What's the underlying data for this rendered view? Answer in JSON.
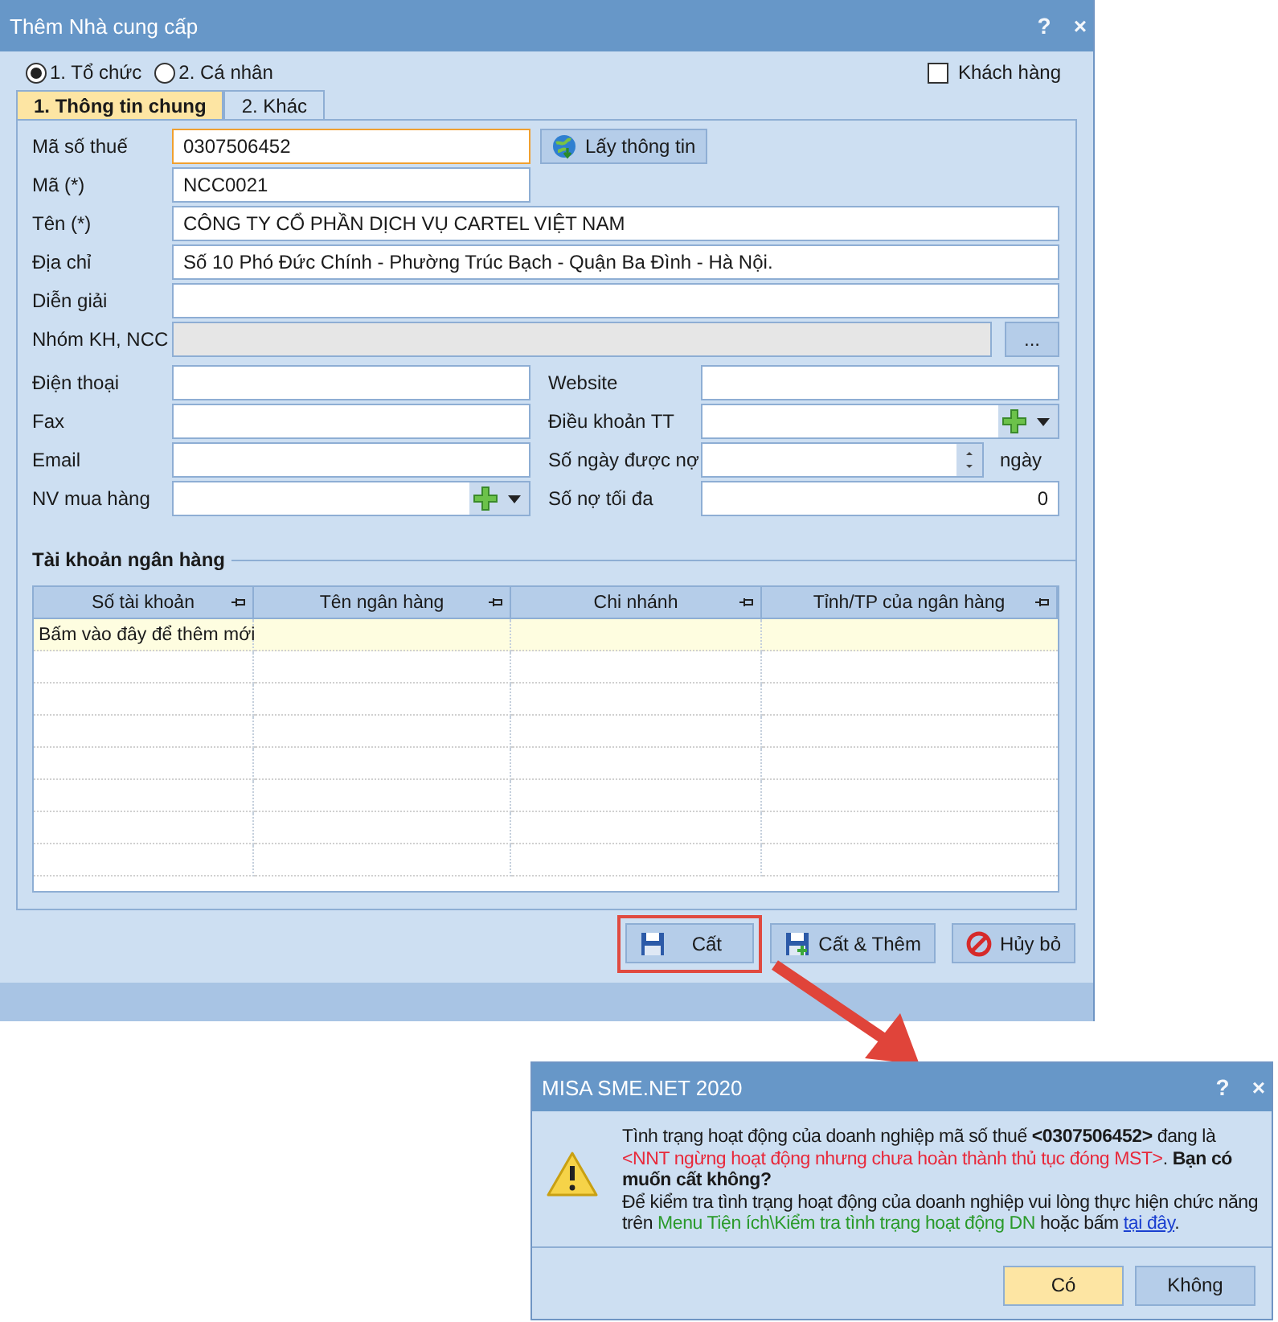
{
  "window": {
    "title": "Thêm Nhà cung cấp",
    "help": "?",
    "close": "×"
  },
  "radio_options": [
    {
      "label": "1. Tổ chức",
      "selected": true
    },
    {
      "label": "2. Cá nhân",
      "selected": false
    }
  ],
  "customer_checkbox": {
    "label": "Khách hàng",
    "checked": false
  },
  "tabs": [
    {
      "label": "1. Thông tin chung",
      "selected": true
    },
    {
      "label": "2. Khác",
      "selected": false
    }
  ],
  "main_fields": [
    {
      "kind": "lookup",
      "label": "Mã số thuế",
      "value": "0307506452",
      "focused": true,
      "button": "Lấy thông tin"
    },
    {
      "kind": "short",
      "label": "Mã (*)",
      "value": "NCC0021",
      "focused": false
    },
    {
      "kind": "text",
      "label": "Tên (*)",
      "value": "CÔNG TY CỔ PHẦN DỊCH VỤ CARTEL VIỆT NAM",
      "focused": false
    },
    {
      "kind": "text",
      "label": "Địa chỉ",
      "value": "Số 10 Phó Đức Chính - Phường Trúc Bạch - Quận Ba Đình - Hà Nội.",
      "focused": false
    },
    {
      "kind": "text",
      "label": "Diễn giải",
      "focused": false
    },
    {
      "kind": "picker",
      "label": "Nhóm KH, NCC",
      "focused": false,
      "disabled": true,
      "button": "..."
    }
  ],
  "left_fields": [
    {
      "kind": "text",
      "label": "Điện thoại"
    },
    {
      "kind": "text",
      "label": "Fax"
    },
    {
      "kind": "text",
      "label": "Email"
    },
    {
      "kind": "combo",
      "label": "NV mua hàng"
    }
  ],
  "right_fields": [
    {
      "kind": "text",
      "label": "Website"
    },
    {
      "kind": "combo",
      "label": "Điều khoản TT"
    },
    {
      "kind": "spin",
      "label": "Số ngày được nợ",
      "unit": "ngày"
    },
    {
      "kind": "number",
      "label": "Số nợ tối đa",
      "value": "0"
    }
  ],
  "bank_accounts": {
    "title": "Tài khoản ngân hàng",
    "columns": [
      "Số tài khoản",
      "Tên ngân hàng",
      "Chi nhánh",
      "Tỉnh/TP của ngân hàng"
    ],
    "new_row_hint": "Bấm vào đây để thêm mới"
  },
  "buttons": [
    {
      "kind": "save",
      "label": "Cất",
      "highlighted": true
    },
    {
      "kind": "save_add",
      "label": "Cất & Thêm",
      "highlighted": false
    },
    {
      "kind": "cancel",
      "label": "Hủy bỏ",
      "highlighted": false
    }
  ],
  "popup": {
    "title": "MISA SME.NET 2020",
    "help": "?",
    "close": "×",
    "message": [
      {
        "kind": "plain",
        "text": "Tình trạng hoạt động của doanh nghiệp mã số thuế "
      },
      {
        "kind": "bold",
        "text": "<0307506452>"
      },
      {
        "kind": "plain",
        "text": " đang là "
      },
      {
        "kind": "red",
        "text": "<NNT ngừng hoạt động nhưng chưa hoàn thành thủ tục đóng MST>"
      },
      {
        "kind": "plain",
        "text": ". "
      },
      {
        "kind": "bold",
        "text": "Bạn có muốn cất không?"
      },
      {
        "kind": "break"
      },
      {
        "kind": "plain",
        "text": "Để kiểm tra tình trạng hoạt động của doanh nghiệp vui lòng thực hiện chức năng trên "
      },
      {
        "kind": "green",
        "text": "Menu Tiện ích\\Kiểm tra tình trạng hoạt động DN"
      },
      {
        "kind": "plain",
        "text": " hoặc bấm "
      },
      {
        "kind": "link",
        "text": "tại đây"
      },
      {
        "kind": "plain",
        "text": "."
      }
    ],
    "buttons": [
      {
        "label": "Có",
        "selected": true
      },
      {
        "label": "Không",
        "selected": false
      }
    ]
  }
}
